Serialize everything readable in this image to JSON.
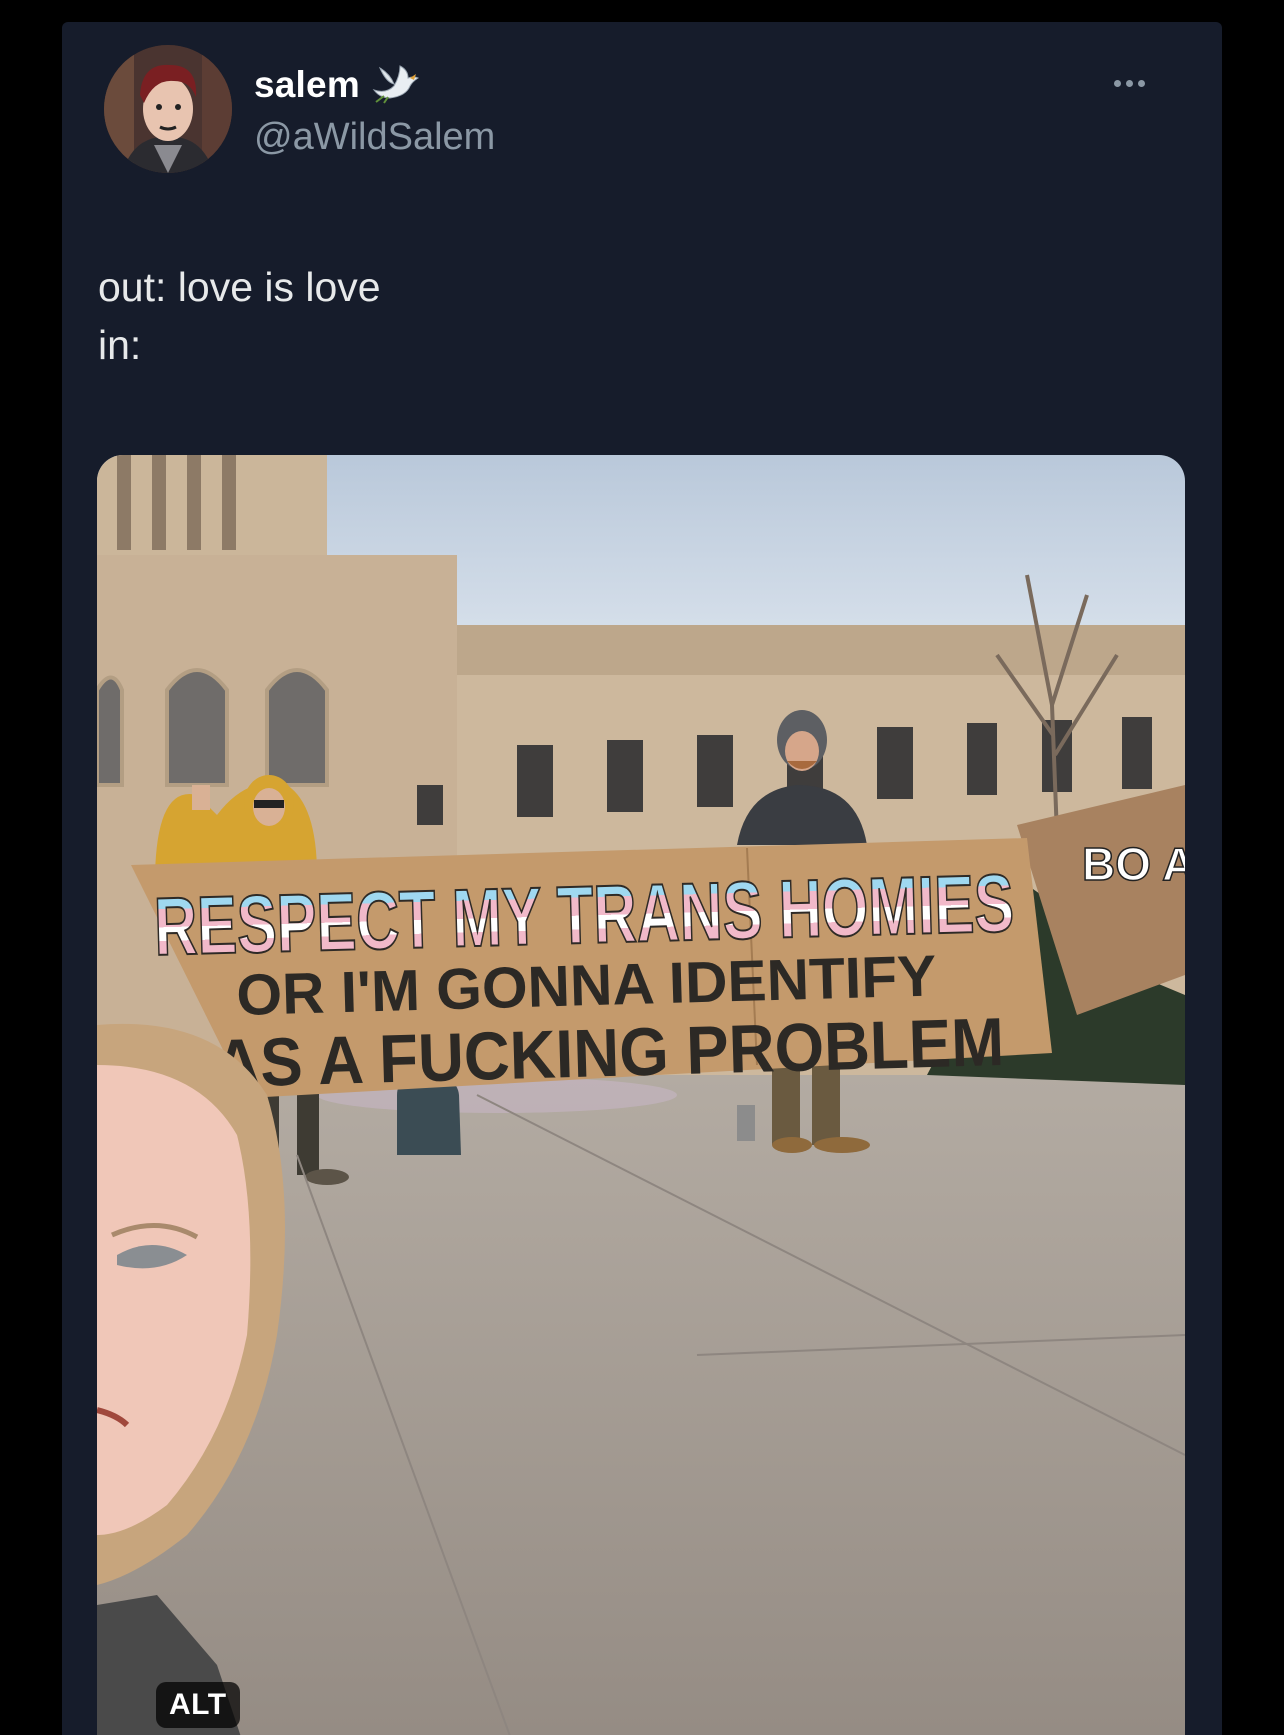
{
  "post": {
    "author": {
      "display_name": "salem",
      "handle": "@aWildSalem",
      "badge_icon": "dove-emoji-icon"
    },
    "more_icon": "more-dots-icon",
    "text_lines": [
      "out: love is love",
      "in:"
    ],
    "media": {
      "alt_label": "ALT",
      "sign": {
        "line1": "RESPECT MY TRANS HOMIES",
        "line2": "OR I'M GONNA IDENTIFY",
        "line3": "AS A FUCKING PROBLEM",
        "side_sign_letters": "BO A"
      }
    }
  },
  "colors": {
    "card_bg": "#161c2b",
    "text": "#e7e9ea",
    "secondary_text": "#8b98a5",
    "trans_blue": "#9fd8f0",
    "trans_pink": "#f1b9c9",
    "cardboard": "#c49a6c"
  }
}
